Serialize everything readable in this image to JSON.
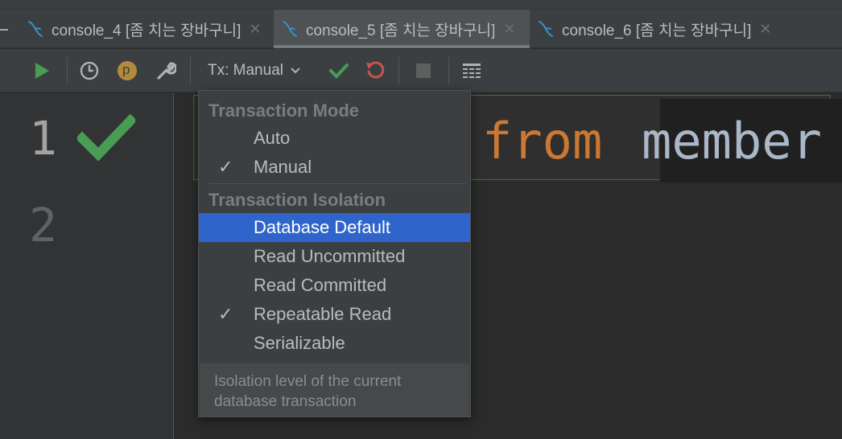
{
  "tabs": [
    {
      "label": "console_4 [좀 치는 장바구니]",
      "active": false
    },
    {
      "label": "console_5 [좀 치는 장바구니]",
      "active": true
    },
    {
      "label": "console_6 [좀 치는 장바구니]",
      "active": false
    }
  ],
  "toolbar": {
    "tx_label": "Tx: Manual",
    "history_badge": "p"
  },
  "editor": {
    "line_numbers": [
      "1",
      "2"
    ],
    "code_keyword": "from",
    "code_ident": "member"
  },
  "popup": {
    "mode_title": "Transaction Mode",
    "mode_items": [
      {
        "label": "Auto",
        "checked": false
      },
      {
        "label": "Manual",
        "checked": true
      }
    ],
    "isolation_title": "Transaction Isolation",
    "isolation_items": [
      {
        "label": "Database Default",
        "checked": false,
        "selected": true
      },
      {
        "label": "Read Uncommitted",
        "checked": false
      },
      {
        "label": "Read Committed",
        "checked": false
      },
      {
        "label": "Repeatable Read",
        "checked": true
      },
      {
        "label": "Serializable",
        "checked": false
      }
    ],
    "check_glyph": "✓",
    "footer": "Isolation level of the current database transaction"
  },
  "icons": {
    "run": "play-icon",
    "history": "clock-icon",
    "profile": "p-badge-icon",
    "settings": "wrench-icon",
    "commit": "check-icon",
    "rollback": "undo-icon",
    "stop": "stop-icon",
    "output": "table-icon",
    "db": "mysql-dolphin-icon"
  },
  "colors": {
    "selection": "#2f65ca",
    "commit_green": "#499c54",
    "rollback_red": "#c75450",
    "keyword_orange": "#cc7832"
  }
}
